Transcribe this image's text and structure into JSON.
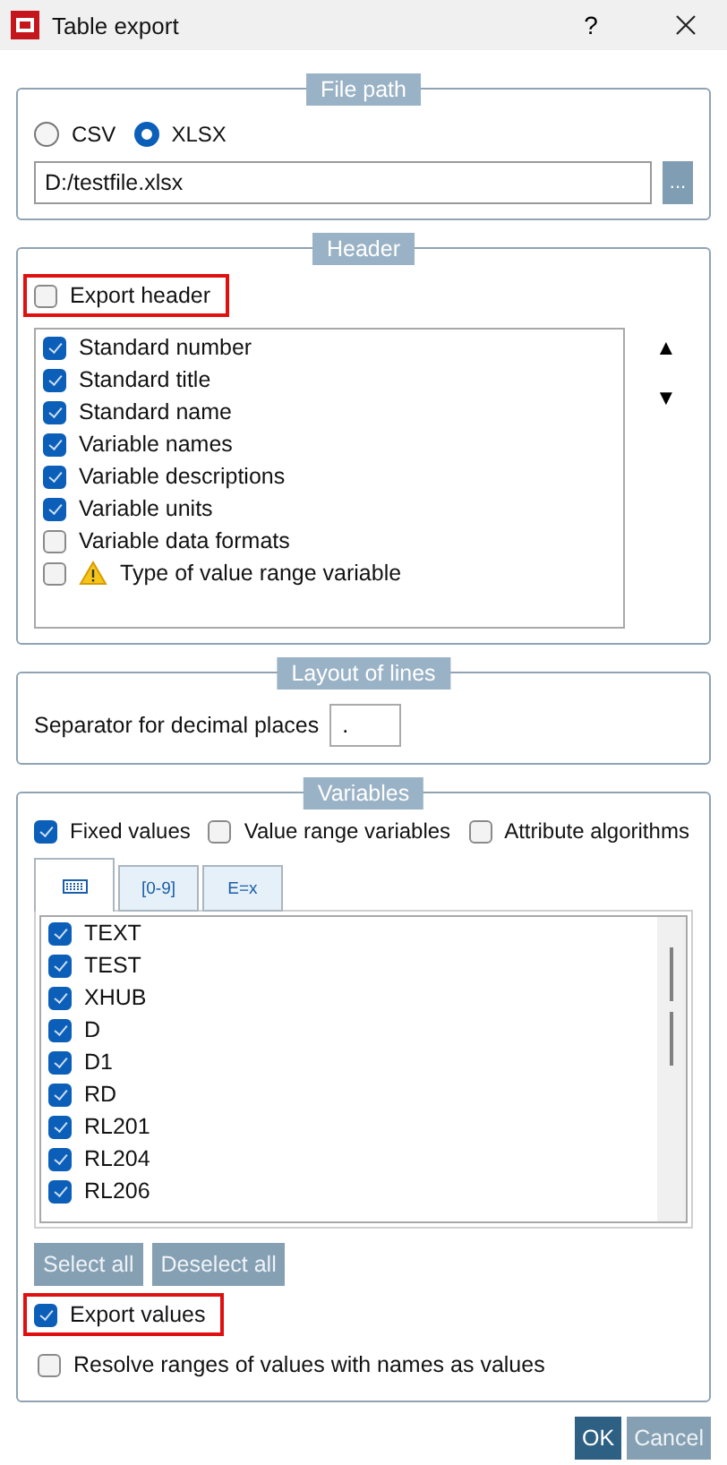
{
  "window": {
    "title": "Table export",
    "help": "?"
  },
  "file_path": {
    "legend": "File path",
    "formats": [
      {
        "label": "CSV",
        "selected": false
      },
      {
        "label": "XLSX",
        "selected": true
      }
    ],
    "path": "D:/testfile.xlsx",
    "browse": "..."
  },
  "header": {
    "legend": "Header",
    "export_header": {
      "label": "Export header",
      "checked": false,
      "highlighted": true
    },
    "items": [
      {
        "label": "Standard number",
        "checked": true,
        "warning": false
      },
      {
        "label": "Standard title",
        "checked": true,
        "warning": false
      },
      {
        "label": "Standard name",
        "checked": true,
        "warning": false
      },
      {
        "label": "Variable names",
        "checked": true,
        "warning": false
      },
      {
        "label": "Variable descriptions",
        "checked": true,
        "warning": false
      },
      {
        "label": "Variable units",
        "checked": true,
        "warning": false
      },
      {
        "label": "Variable data formats",
        "checked": false,
        "warning": false
      },
      {
        "label": "Type of value range variable",
        "checked": false,
        "warning": true
      }
    ],
    "move_up": "▲",
    "move_down": "▼"
  },
  "layout_of_lines": {
    "legend": "Layout of lines",
    "separator_label": "Separator for decimal places",
    "separator_value": "."
  },
  "variables": {
    "legend": "Variables",
    "filters": [
      {
        "label": "Fixed values",
        "checked": true
      },
      {
        "label": "Value range variables",
        "checked": false
      },
      {
        "label": "Attribute algorithms",
        "checked": false
      }
    ],
    "tabs": [
      {
        "kind": "icon",
        "selected": true
      },
      {
        "kind": "text",
        "label": "[0-9]",
        "selected": false
      },
      {
        "kind": "text",
        "label": "E=x",
        "selected": false
      }
    ],
    "items": [
      {
        "label": "TEXT",
        "checked": true
      },
      {
        "label": "TEST",
        "checked": true
      },
      {
        "label": "XHUB",
        "checked": true
      },
      {
        "label": "D",
        "checked": true
      },
      {
        "label": "D1",
        "checked": true
      },
      {
        "label": "RD",
        "checked": true
      },
      {
        "label": "RL201",
        "checked": true
      },
      {
        "label": "RL204",
        "checked": true
      },
      {
        "label": "RL206",
        "checked": true
      }
    ],
    "select_all": "Select all",
    "deselect_all": "Deselect all",
    "export_values": {
      "label": "Export values",
      "checked": true,
      "highlighted": true
    },
    "resolve_ranges": {
      "label": "Resolve ranges of values with names as values",
      "checked": false,
      "highlighted": false
    }
  },
  "buttons": [
    {
      "label": "OK",
      "kind": "primary"
    },
    {
      "label": "Cancel",
      "kind": "secondary"
    }
  ]
}
